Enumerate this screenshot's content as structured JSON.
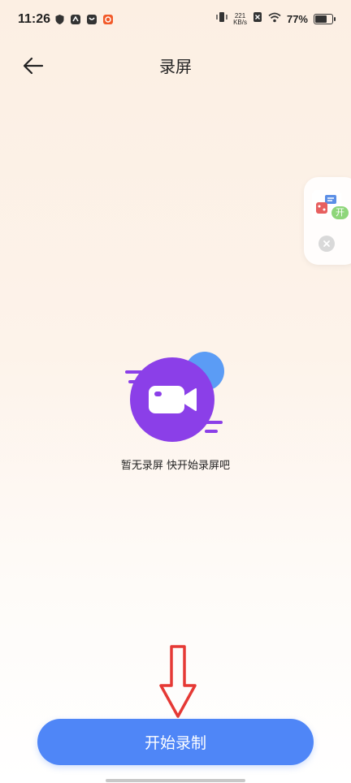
{
  "status_bar": {
    "time": "11:26",
    "net_speed_value": "221",
    "net_speed_unit": "KB/s",
    "battery_percent": "77%",
    "battery_level": 0.77
  },
  "header": {
    "title": "录屏"
  },
  "floating_widget": {
    "badge": "开"
  },
  "empty_state": {
    "message": "暂无录屏 快开始录屏吧"
  },
  "start_button": {
    "label": "开始录制"
  },
  "colors": {
    "accent": "#4f86f7",
    "illustration_purple": "#8b3fe8",
    "illustration_blue": "#5b9cf5",
    "annotation_red": "#e53935"
  }
}
